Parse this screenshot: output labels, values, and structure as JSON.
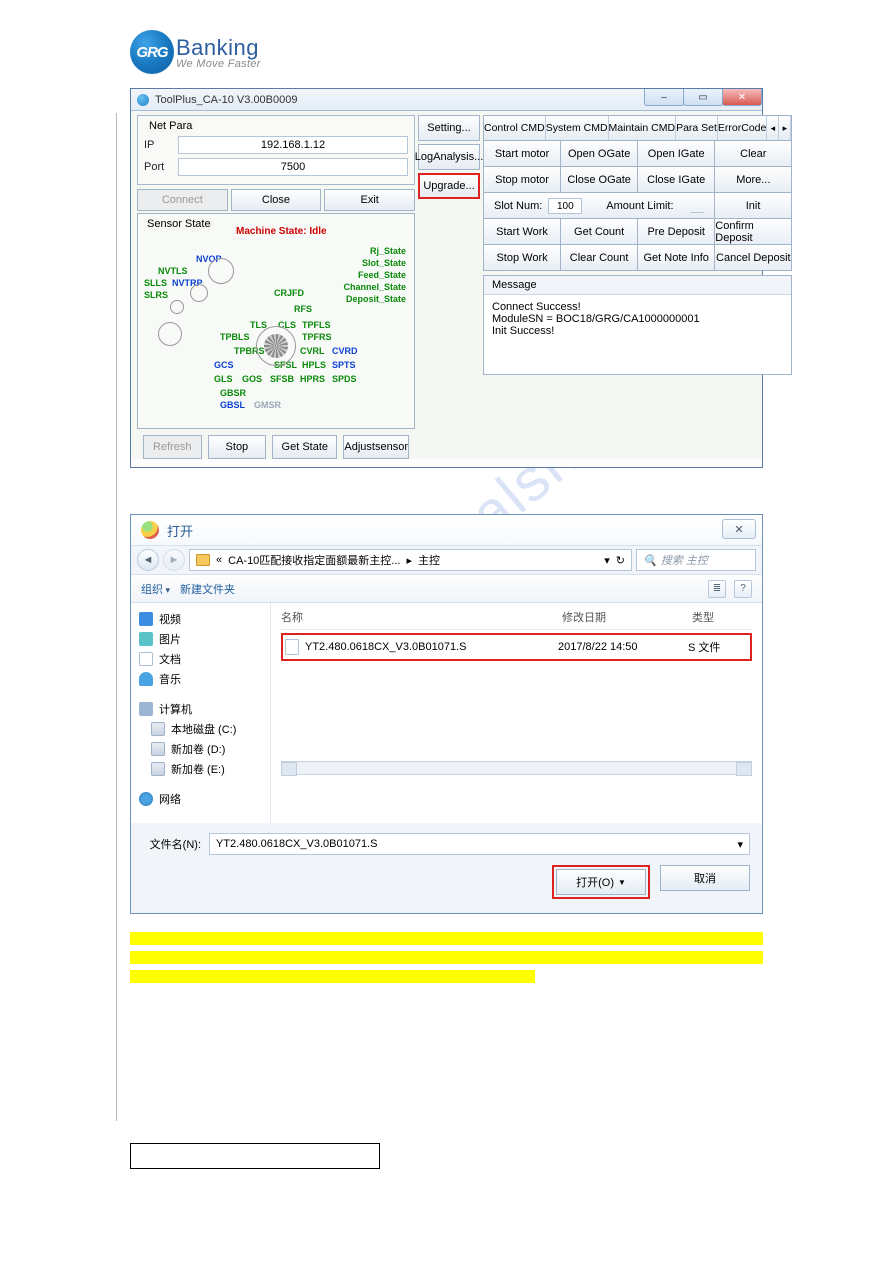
{
  "branding": {
    "logo_letters": "GRG",
    "logo_word": "Banking",
    "tagline": "We Move Faster"
  },
  "watermark": "manualshive.com",
  "app": {
    "title": "ToolPlus_CA-10 V3.00B0009",
    "window_controls": {
      "min": "–",
      "max": "▭",
      "close": "✕"
    },
    "net_para": {
      "legend": "Net Para",
      "ip_label": "IP",
      "ip_value": "192.168.1.12",
      "port_label": "Port",
      "port_value": "7500"
    },
    "conn_buttons": {
      "connect": "Connect",
      "close": "Close",
      "exit": "Exit"
    },
    "cmd_buttons": {
      "setting": "Setting...",
      "log": "LogAnalysis...",
      "upgrade": "Upgrade..."
    },
    "tabs": {
      "control": "Control CMD",
      "system": "System CMD",
      "maintain": "Maintain CMD",
      "para": "Para Set",
      "errorcode": "ErrorCode",
      "nav_left": "◂",
      "nav_right": "▸"
    },
    "grid": {
      "r1": [
        "Start motor",
        "Open OGate",
        "Open IGate",
        "Clear"
      ],
      "r2": [
        "Stop motor",
        "Close OGate",
        "Close IGate",
        "More..."
      ],
      "r3_label_slot": "Slot Num:",
      "r3_slot_value": "100",
      "r3_label_amt": "Amount Limit:",
      "r3_init": "Init",
      "r4": [
        "Start Work",
        "Get Count",
        "Pre Deposit",
        "Confirm Deposit"
      ],
      "r5": [
        "Stop Work",
        "Clear Count",
        "Get Note Info",
        "Cancel Deposit"
      ]
    },
    "message": {
      "legend": "Message",
      "line1": "Connect Success!",
      "line2": "ModuleSN = BOC18/GRG/CA1000000001",
      "line3": "Init Success!"
    },
    "sensor": {
      "legend": "Sensor State",
      "machine_state": "Machine State: Idle",
      "labels_green": [
        "Rj_State",
        "Slot_State",
        "Feed_State",
        "Channel_State",
        "Deposit_State",
        "SLLS",
        "NVTLS",
        "SLRS",
        "CRJFD",
        "RFS",
        "TLS",
        "CLS",
        "TPFLS",
        "TPFRS",
        "CVRL",
        "HPLS",
        "GLS",
        "GOS",
        "SFSB",
        "HPRS",
        "SPDS",
        "GBSR",
        "TPBLS",
        "TPBRS",
        "SFSL"
      ],
      "labels_blue": [
        "NVOP",
        "NVTRP",
        "GCS",
        "CVRD",
        "SPTS",
        "GBSL"
      ],
      "labels_gray": [
        "GMSR"
      ]
    },
    "bottom": {
      "refresh": "Refresh",
      "stop": "Stop",
      "get_state": "Get State",
      "adjust": "Adjustsensor"
    }
  },
  "open_dialog": {
    "title": "打开",
    "close_x": "✕",
    "nav": {
      "back": "◄",
      "fwd": "►"
    },
    "breadcrumb": {
      "folder": "CA-10匹配接收指定面额最新主控...",
      "sep": "▸",
      "child": "主控",
      "drop": "▾"
    },
    "refresh_icon": "↻",
    "search_placeholder": "搜索 主控",
    "toolbar": {
      "org": "组织",
      "new_folder": "新建文件夹"
    },
    "view_icons": {
      "list": "≣",
      "help": "?"
    },
    "side": {
      "video": "视频",
      "pics": "图片",
      "docs": "文档",
      "music": "音乐",
      "computer": "计算机",
      "cdrive": "本地磁盘 (C:)",
      "ddrive": "新加卷 (D:)",
      "edrive": "新加卷 (E:)",
      "network": "网络"
    },
    "file_header": {
      "name": "名称",
      "date": "修改日期",
      "type": "类型"
    },
    "file": {
      "name": "YT2.480.0618CX_V3.0B01071.S",
      "date": "2017/8/22 14:50",
      "type": "S 文件"
    },
    "fname_label": "文件名(N):",
    "fname_value": "YT2.480.0618CX_V3.0B01071.S",
    "open_btn": "打开(O)",
    "cancel_btn": "取消"
  }
}
